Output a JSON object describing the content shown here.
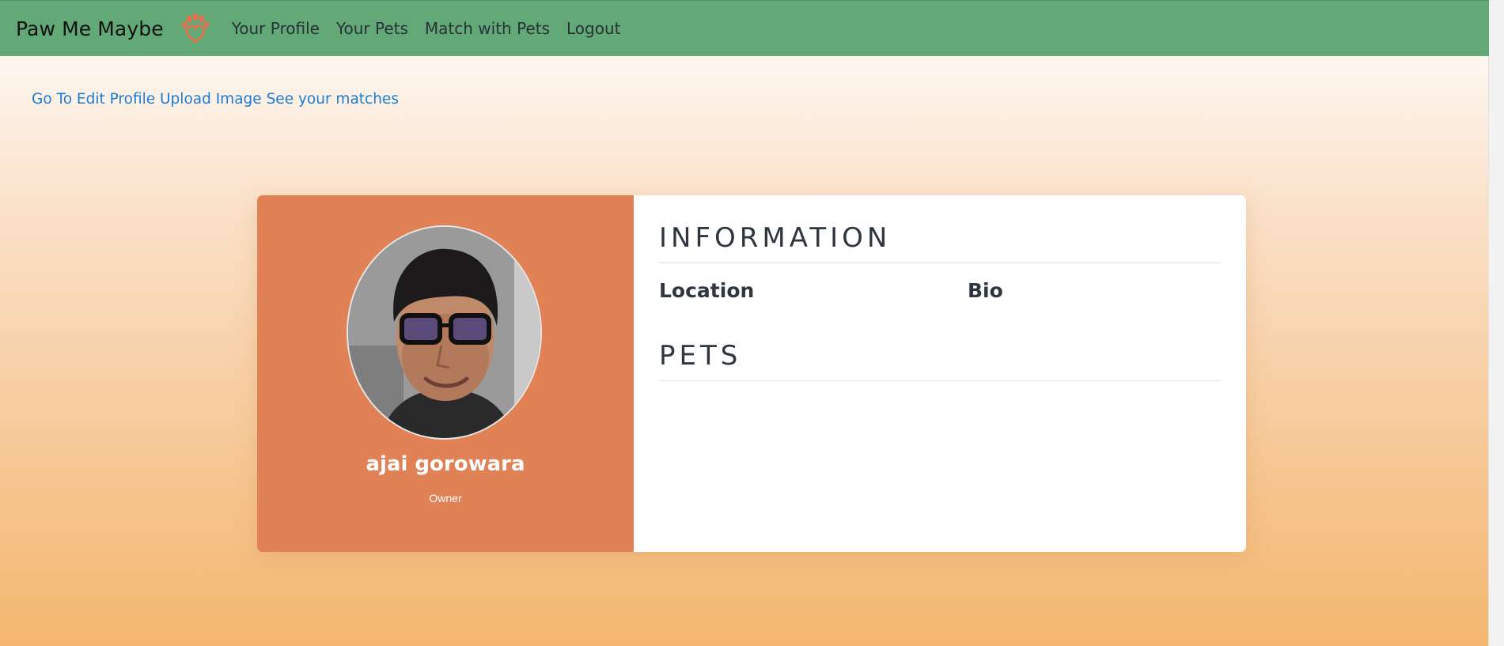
{
  "navbar": {
    "brand": "Paw Me Maybe",
    "logo_icon": "paw-heart-icon",
    "background": "#63a877",
    "links": [
      {
        "label": "Your Profile"
      },
      {
        "label": "Your Pets"
      },
      {
        "label": "Match with Pets"
      },
      {
        "label": "Logout"
      }
    ]
  },
  "actions": {
    "edit_profile": "Go To Edit Profile",
    "upload_image": "Upload Image",
    "see_matches": "See your matches",
    "color": "#1a7bd8"
  },
  "profile": {
    "name": "ajai gorowara",
    "role": "Owner",
    "panel_color": "#e08156"
  },
  "information": {
    "heading": "INFORMATION",
    "location_label": "Location",
    "bio_label": "Bio"
  },
  "pets": {
    "heading": "PETS"
  }
}
